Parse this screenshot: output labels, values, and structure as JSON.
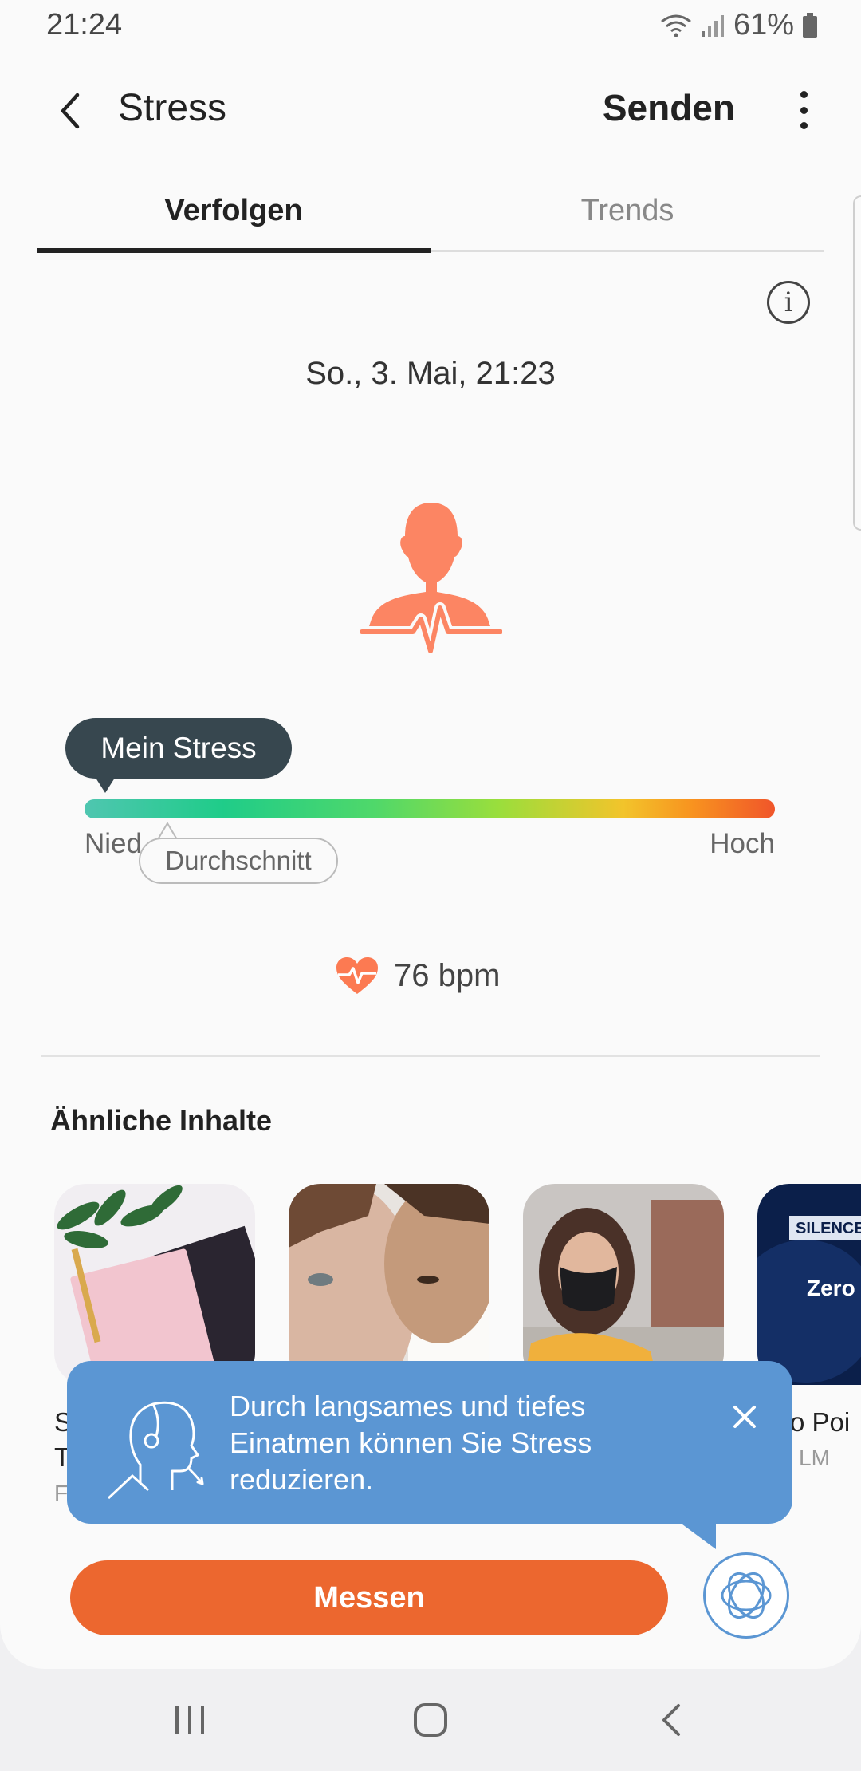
{
  "status_bar": {
    "time": "21:24",
    "battery": "61%"
  },
  "header": {
    "title": "Stress",
    "send_label": "Senden"
  },
  "tabs": [
    {
      "label": "Verfolgen",
      "active": true
    },
    {
      "label": "Trends",
      "active": false
    }
  ],
  "measurement": {
    "date": "So., 3. Mai, 21:23",
    "gauge": {
      "my_label": "Mein Stress",
      "low_label": "Nied",
      "high_label": "Hoch",
      "average_label": "Durchschnitt",
      "my_level_fraction": 0.03,
      "average_level_fraction": 0.12
    },
    "bpm": "76 bpm"
  },
  "similar": {
    "title": "Ähnliche Inhalte",
    "items": [
      {
        "title_line1": "S",
        "title_line2": "T",
        "subtitle": "F"
      },
      {
        "title_line1": "",
        "title_line2": "",
        "subtitle": ""
      },
      {
        "title_line1": "",
        "title_line2": "",
        "subtitle": ""
      },
      {
        "title_line1": "ro Poi",
        "title_line2": "",
        "subtitle": "LM",
        "cover_text": "Zero P",
        "cover_brand": "SILENCE"
      }
    ]
  },
  "tip": {
    "text": "Durch langsames und tiefes Einatmen können Sie Stress reduzieren."
  },
  "actions": {
    "measure_label": "Messen"
  },
  "colors": {
    "accent_orange": "#ec672f",
    "figure_orange": "#fc8563",
    "tip_blue": "#5b96d3",
    "bubble_dark": "#37474f"
  },
  "icons": {
    "back": "chevron-left-icon",
    "more": "more-vertical-icon",
    "info": "info-icon",
    "heart": "heart-rate-icon",
    "close": "close-icon",
    "breathe": "breathe-icon"
  }
}
